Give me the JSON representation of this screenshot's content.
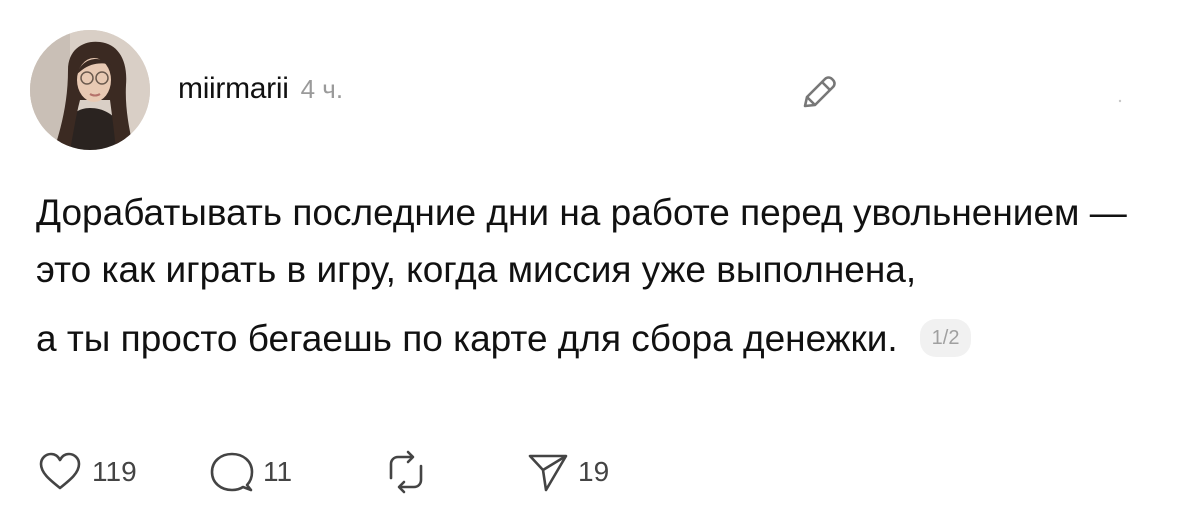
{
  "post": {
    "author": {
      "username": "miirmarii",
      "avatar_icon": "profile-photo"
    },
    "time_ago": "4 ч.",
    "text": {
      "paragraph_1": "Дорабатывать последние дни на работе перед увольнением — это как играть в игру, когда миссия уже выполнена,",
      "paragraph_2": "а ты просто бегаешь по карте для сбора денежки."
    },
    "thread_page": "1/2",
    "actions": {
      "like": {
        "icon": "heart-icon",
        "count": "119"
      },
      "comment": {
        "icon": "comment-icon",
        "count": "11"
      },
      "repost": {
        "icon": "repost-icon",
        "count": ""
      },
      "share": {
        "icon": "send-icon",
        "count": "19"
      }
    }
  },
  "colors": {
    "text": "#111111",
    "muted": "#9a9a9a",
    "icon": "#444444",
    "pager_bg": "#f1f1f1"
  }
}
